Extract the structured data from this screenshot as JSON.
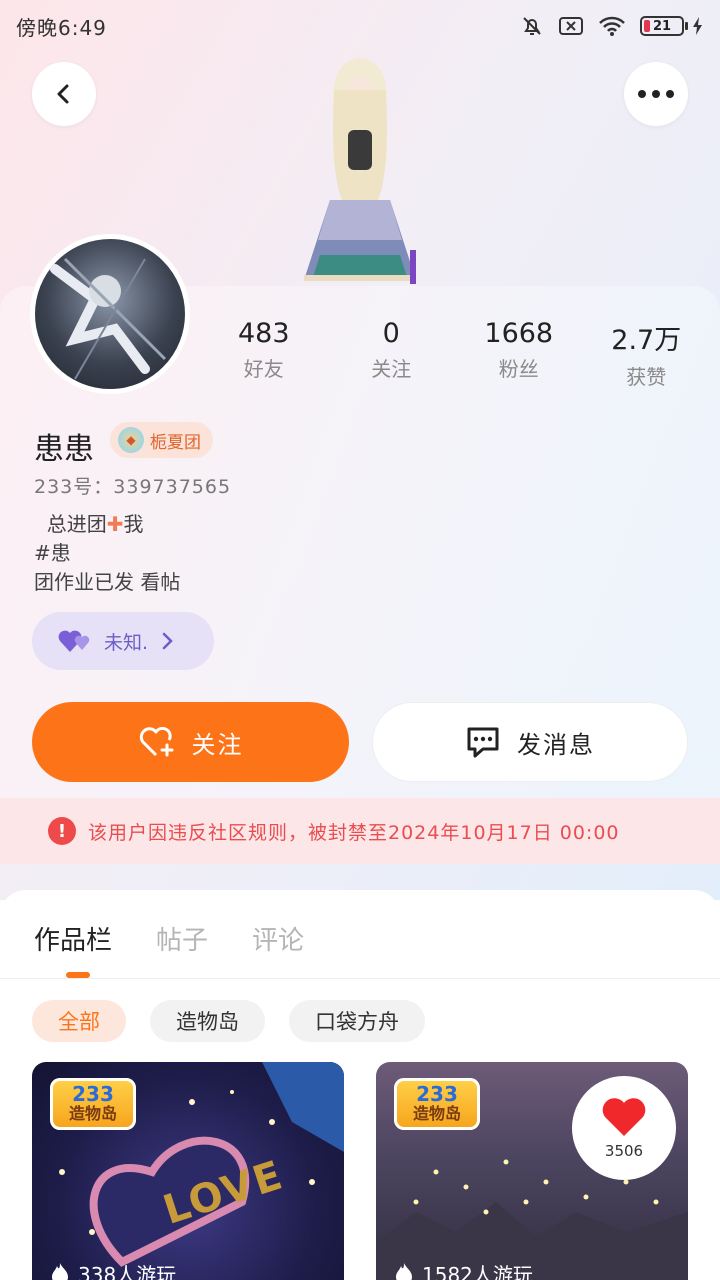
{
  "status_bar": {
    "time": "傍晚6:49",
    "battery": "21"
  },
  "profile": {
    "stats": [
      {
        "value": "483",
        "label": "好友"
      },
      {
        "value": "0",
        "label": "关注"
      },
      {
        "value": "1668",
        "label": "粉丝"
      },
      {
        "value": "2.7万",
        "label": "获赞"
      }
    ],
    "username": "患患",
    "group_badge": "栀夏团",
    "user_id": "233号：339737565",
    "bio_lines": [
      "总进团",
      "我",
      "#患",
      "团作业已发 看帖"
    ],
    "relation_chip": "未知."
  },
  "actions": {
    "follow_label": "关注",
    "message_label": "发消息"
  },
  "ban_notice": "该用户因违反社区规则，被封禁至2024年10月17日 00:00",
  "tabs": [
    {
      "label": "作品栏",
      "active": true
    },
    {
      "label": "帖子",
      "active": false
    },
    {
      "label": "评论",
      "active": false
    }
  ],
  "filters": [
    {
      "label": "全部",
      "active": true
    },
    {
      "label": "造物岛",
      "active": false
    },
    {
      "label": "口袋方舟",
      "active": false
    }
  ],
  "cards": [
    {
      "logo_num": "233",
      "logo_name": "造物岛",
      "players": "338人游玩",
      "overlay_text": "LOVE"
    },
    {
      "logo_num": "233",
      "logo_name": "造物岛",
      "players": "1582人游玩",
      "likes": "3506"
    }
  ],
  "colors": {
    "accent": "#fd7418",
    "ban_text": "#ea4d4f",
    "relation": "#6b5fc7"
  }
}
